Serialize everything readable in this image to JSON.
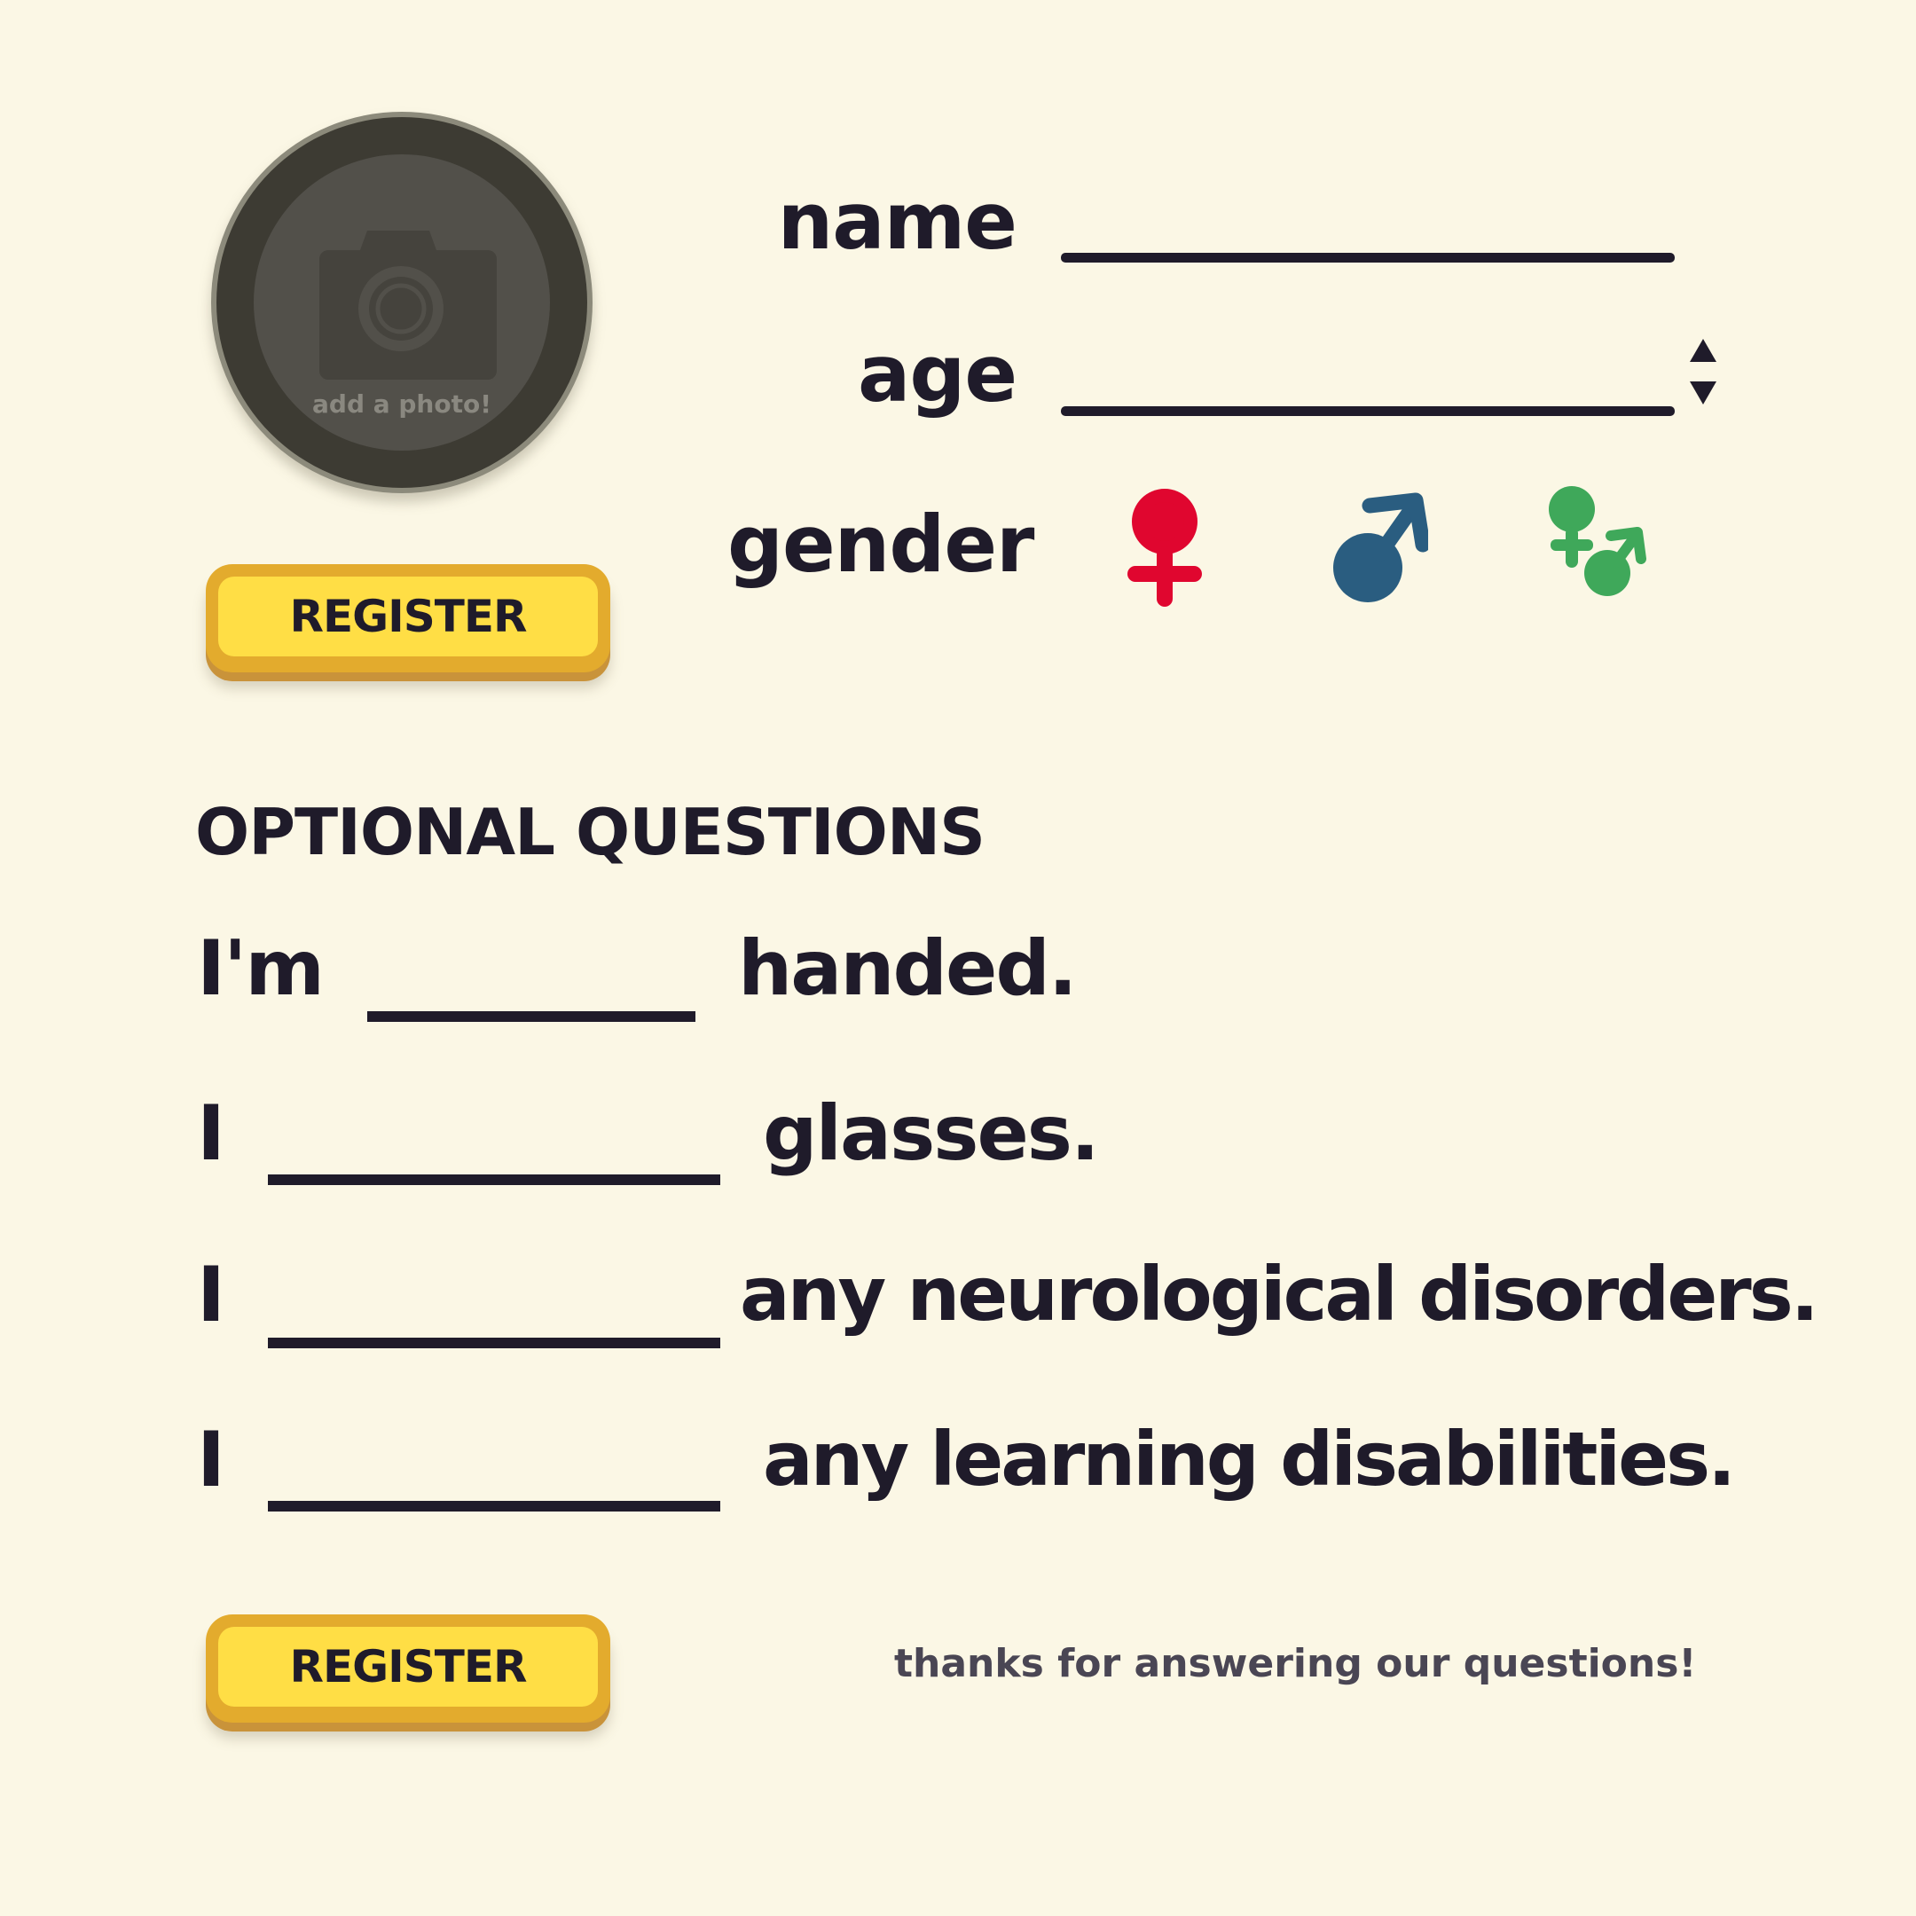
{
  "photo": {
    "label": "add a photo!",
    "icon": "camera-icon"
  },
  "register_button_label": "REGISTER",
  "form": {
    "name_label": "name",
    "name_value": "",
    "age_label": "age",
    "age_value": "",
    "gender_label": "gender",
    "gender_options": [
      {
        "icon": "female-symbol-icon",
        "color": "#e0062f"
      },
      {
        "icon": "male-symbol-icon",
        "color": "#2a5d80"
      },
      {
        "icon": "intersex-symbol-icon",
        "color": "#3fa85a"
      }
    ]
  },
  "optional": {
    "title": "OPTIONAL QUESTIONS",
    "questions": [
      {
        "prefix": "I'm",
        "suffix": "handed.",
        "answer": ""
      },
      {
        "prefix": "I",
        "suffix": "glasses.",
        "answer": ""
      },
      {
        "prefix": "I",
        "suffix": "any neurological disorders.",
        "answer": ""
      },
      {
        "prefix": "I",
        "suffix": "any learning disabilities.",
        "answer": ""
      }
    ]
  },
  "footer": {
    "thanks": "thanks for answering our questions!"
  },
  "colors": {
    "background": "#fbf7e5",
    "text": "#1f1b2a",
    "button_face": "#ffde45",
    "button_rim": "#e3ab2d"
  }
}
